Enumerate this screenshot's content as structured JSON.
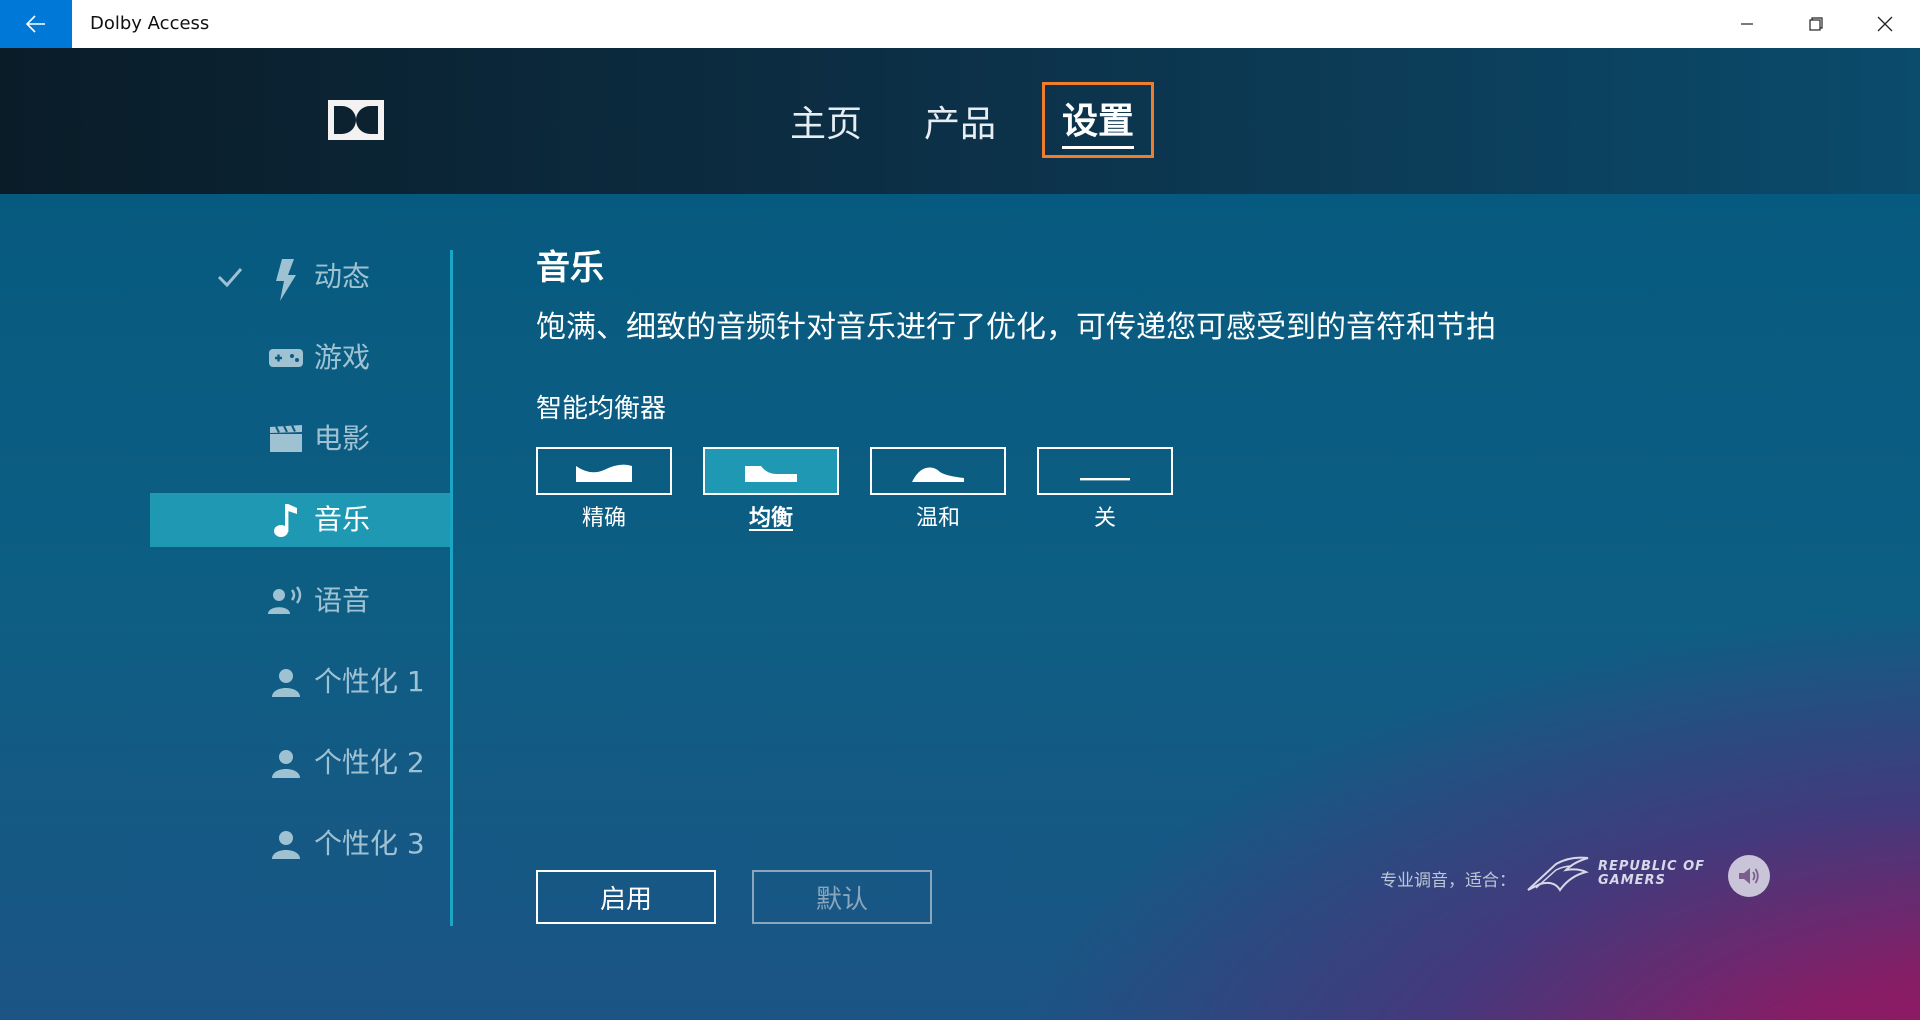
{
  "window": {
    "title": "Dolby Access"
  },
  "nav": {
    "tabs": [
      {
        "label": "主页",
        "active": false
      },
      {
        "label": "产品",
        "active": false
      },
      {
        "label": "设置",
        "active": true
      }
    ]
  },
  "sidebar": {
    "items": [
      {
        "label": "动态",
        "icon": "lightning-icon",
        "checked": true,
        "active": false
      },
      {
        "label": "游戏",
        "icon": "gamepad-icon",
        "checked": false,
        "active": false
      },
      {
        "label": "电影",
        "icon": "clapperboard-icon",
        "checked": false,
        "active": false
      },
      {
        "label": "音乐",
        "icon": "music-note-icon",
        "checked": false,
        "active": true
      },
      {
        "label": "语音",
        "icon": "voice-icon",
        "checked": false,
        "active": false
      },
      {
        "label": "个性化 1",
        "icon": "person-icon",
        "checked": false,
        "active": false
      },
      {
        "label": "个性化 2",
        "icon": "person-icon",
        "checked": false,
        "active": false
      },
      {
        "label": "个性化 3",
        "icon": "person-icon",
        "checked": false,
        "active": false
      }
    ]
  },
  "content": {
    "title": "音乐",
    "description": "饱满、细致的音频针对音乐进行了优化，可传递您可感受到的音符和节拍",
    "equalizer": {
      "title": "智能均衡器",
      "options": [
        {
          "label": "精确",
          "selected": false
        },
        {
          "label": "均衡",
          "selected": true
        },
        {
          "label": "温和",
          "selected": false
        },
        {
          "label": "关",
          "selected": false
        }
      ]
    },
    "apply_label": "启用",
    "default_label": "默认"
  },
  "footer": {
    "tuned_text": "专业调音，适合：",
    "rog_line1": "REPUBLIC OF",
    "rog_line2": "GAMERS"
  },
  "colors": {
    "accent": "#0078d7",
    "selected_bg": "#1f98b4",
    "highlight_border": "#ef7d2b"
  }
}
